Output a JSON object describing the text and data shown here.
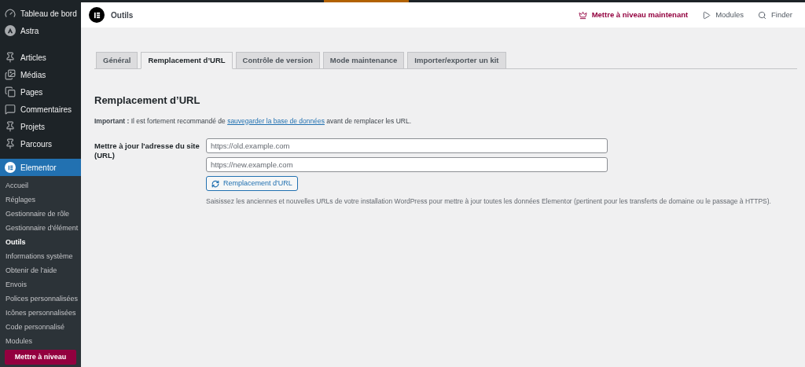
{
  "sidebar": {
    "menu": [
      {
        "label": "Tableau de bord",
        "kind": "gauge",
        "selected": false
      },
      {
        "label": "Astra",
        "kind": "astra",
        "selected": false
      },
      {
        "label": "Articles",
        "kind": "pin",
        "selected": false
      },
      {
        "label": "Médias",
        "kind": "media",
        "selected": false
      },
      {
        "label": "Pages",
        "kind": "pages",
        "selected": false
      },
      {
        "label": "Commentaires",
        "kind": "comment",
        "selected": false
      },
      {
        "label": "Projets",
        "kind": "pin",
        "selected": false
      },
      {
        "label": "Parcours",
        "kind": "pin",
        "selected": false
      },
      {
        "label": "Elementor",
        "kind": "elementor",
        "selected": true
      }
    ],
    "submenu": [
      {
        "label": "Accueil",
        "selected": false
      },
      {
        "label": "Réglages",
        "selected": false
      },
      {
        "label": "Gestionnaire de rôle",
        "selected": false
      },
      {
        "label": "Gestionnaire d'élément",
        "selected": false
      },
      {
        "label": "Outils",
        "selected": true
      },
      {
        "label": "Informations système",
        "selected": false
      },
      {
        "label": "Obtenir de l'aide",
        "selected": false
      },
      {
        "label": "Envois",
        "selected": false
      },
      {
        "label": "Polices personnalisées",
        "selected": false
      },
      {
        "label": "Icônes personnalisées",
        "selected": false
      },
      {
        "label": "Code personnalisé",
        "selected": false
      },
      {
        "label": "Modules",
        "selected": false
      }
    ],
    "upgrade_button": "Mettre à niveau"
  },
  "top_bar": {
    "title": "Outils",
    "actions": [
      {
        "label": "Mettre à niveau maintenant",
        "kind": "crown"
      },
      {
        "label": "Modules",
        "kind": "play"
      },
      {
        "label": "Finder",
        "kind": "search"
      }
    ]
  },
  "tabs": [
    {
      "label": "Général",
      "selected": false
    },
    {
      "label": "Remplacement d’URL",
      "selected": true
    },
    {
      "label": "Contrôle de version",
      "selected": false
    },
    {
      "label": "Mode maintenance",
      "selected": false
    },
    {
      "label": "Importer/exporter un kit",
      "selected": false
    }
  ],
  "section": {
    "heading": "Remplacement d’URL",
    "notice": {
      "before": "**Important :** Il est fortement recommandé de ",
      "link": "sauvegarder la base de données",
      "after": " avant de remplacer les URL."
    },
    "field_label": "Mettre à jour l'adresse du site (URL)",
    "inputs": [
      {
        "placeholder": "https://old.example.com"
      },
      {
        "placeholder": "https://new.example.com"
      }
    ],
    "button": "Remplacement d'URL",
    "description": "Saisissez les anciennes et nouvelles URLs de votre installation WordPress pour mettre à jour toutes les données Elementor (pertinent pour les transferts de domaine ou le passage à HTTPS)."
  }
}
